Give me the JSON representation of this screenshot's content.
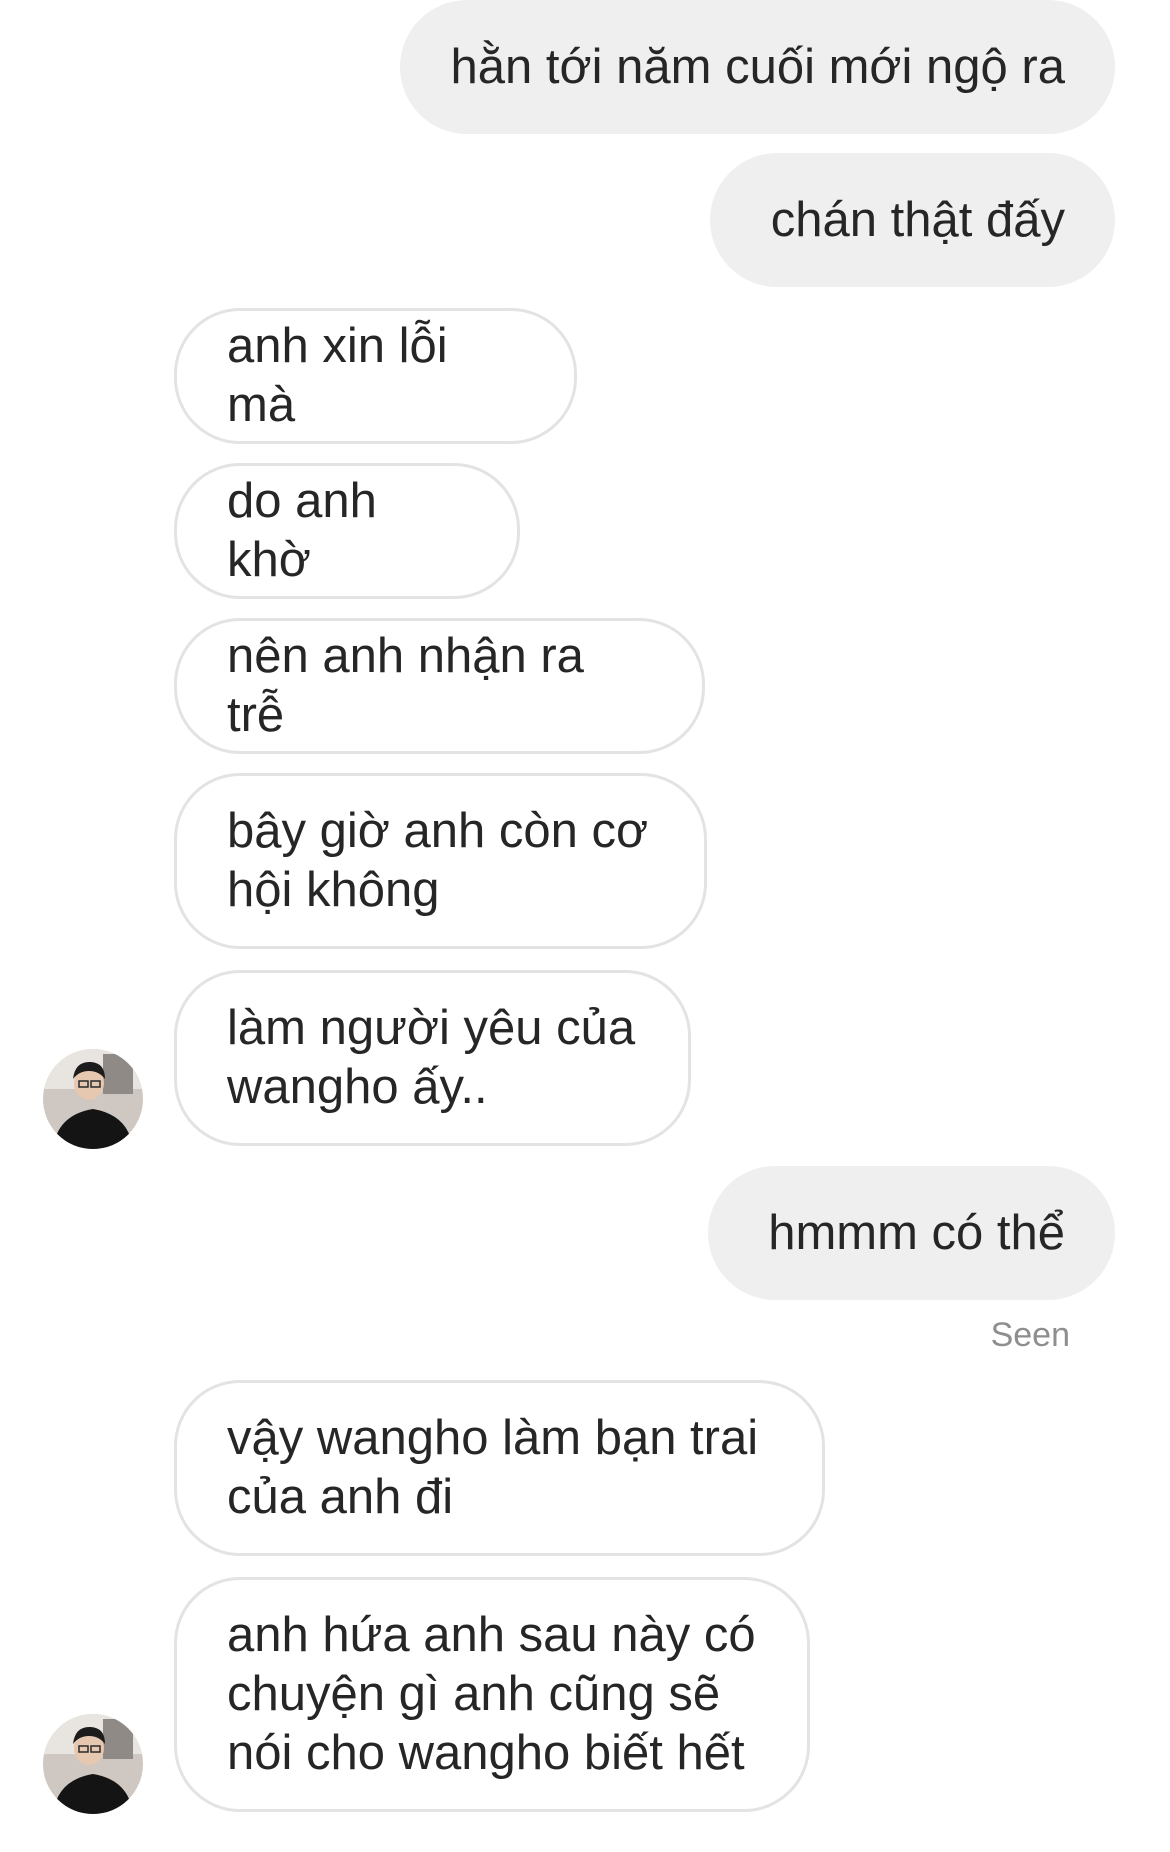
{
  "messages": [
    {
      "direction": "outgoing",
      "text": "hằn tới năm cuối mới ngộ ra"
    },
    {
      "direction": "outgoing",
      "text": "chán thật đấy"
    },
    {
      "direction": "incoming",
      "text": "anh xin lỗi mà"
    },
    {
      "direction": "incoming",
      "text": "do anh khờ"
    },
    {
      "direction": "incoming",
      "text": "nên anh nhận ra trễ"
    },
    {
      "direction": "incoming",
      "text": "bây giờ anh còn cơ\nhội không"
    },
    {
      "direction": "incoming",
      "text": "làm người yêu của\nwangho ấy.."
    },
    {
      "direction": "outgoing",
      "text": "hmmm có thể"
    },
    {
      "direction": "incoming",
      "text": "vậy wangho làm bạn trai\ncủa anh đi"
    },
    {
      "direction": "incoming",
      "text": "anh hứa anh sau này có\nchuyện gì anh cũng sẽ\nnói cho wangho biết hết"
    }
  ],
  "status": {
    "seen": "Seen"
  },
  "icons": {
    "avatar": "contact-avatar"
  },
  "colors": {
    "outgoing_bubble": "#efefef",
    "incoming_border": "#e3e3e3",
    "text": "#262626",
    "seen_text": "#8e8e8e"
  }
}
